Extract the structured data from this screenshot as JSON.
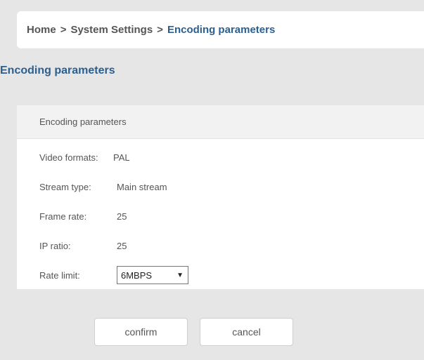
{
  "breadcrumb": {
    "home": "Home",
    "separator1": ">",
    "section": "System Settings",
    "separator2": ">",
    "current": "Encoding parameters"
  },
  "page_title": "Encoding parameters",
  "panel": {
    "header": "Encoding parameters",
    "rows": [
      {
        "label": "Video formats:",
        "value": "PAL"
      },
      {
        "label": "Stream type:",
        "value": "Main stream"
      },
      {
        "label": "Frame rate:",
        "value": "25"
      },
      {
        "label": "IP ratio:",
        "value": "25"
      }
    ],
    "rate_limit": {
      "label": "Rate limit:",
      "selected": "6MBPS",
      "arrow": "▼"
    }
  },
  "buttons": {
    "confirm": "confirm",
    "cancel": "cancel"
  },
  "colors": {
    "background": "#e6e6e6",
    "accent": "#2c5f8e",
    "panel_header": "#f2f2f2",
    "text": "#555555"
  }
}
